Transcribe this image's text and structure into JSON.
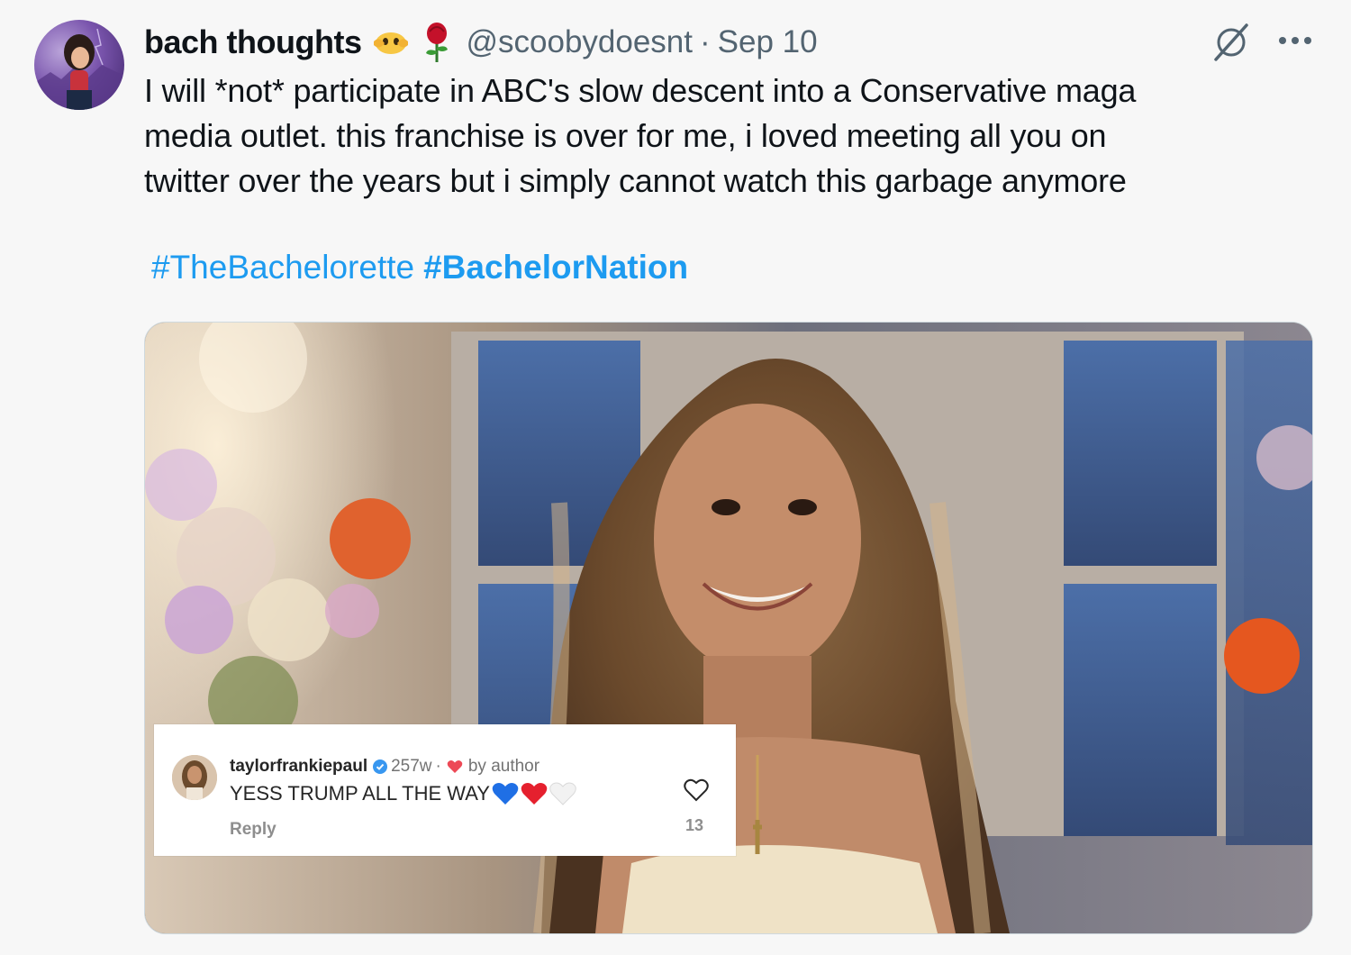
{
  "tweet": {
    "display_name": "bach thoughts",
    "name_emojis": [
      "eyes-in-hands-emoji",
      "rose-emoji"
    ],
    "handle": "@scoobydoesnt",
    "separator": "·",
    "date": "Sep 10",
    "text_lines": [
      "I will *not* participate in ABC's slow descent into a Conservative maga",
      "media outlet. this franchise is over for me, i loved meeting all you on",
      "twitter over the years but i simply cannot watch this garbage anymore"
    ],
    "hashtags": [
      "#TheBachelorette",
      "#BachelorNation"
    ],
    "icons": {
      "grok": "grok-icon",
      "more": "more-icon"
    },
    "colors": {
      "link": "#1d9bf0",
      "secondary": "#536471",
      "text": "#0f1419"
    }
  },
  "media": {
    "embedded_comment": {
      "username": "taylorfrankiepaul",
      "age": "257w",
      "dot": "·",
      "liked_by": "by author",
      "text": "YESS TRUMP ALL THE WAY",
      "emojis": [
        "blue-heart-emoji",
        "red-heart-emoji",
        "white-heart-emoji"
      ],
      "reply_label": "Reply",
      "like_count": "13"
    }
  }
}
